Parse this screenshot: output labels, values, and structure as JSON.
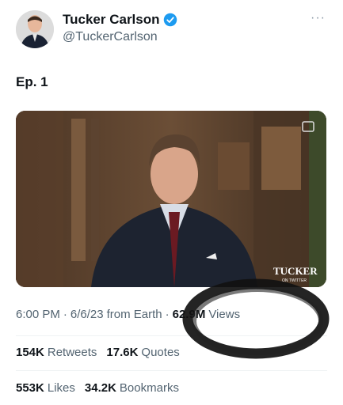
{
  "author": {
    "name": "Tucker Carlson",
    "handle": "@TuckerCarlson"
  },
  "tweet": {
    "text": "Ep. 1"
  },
  "video": {
    "watermark_main": "TUCKER",
    "watermark_sub": "ON TWITTER"
  },
  "meta": {
    "time": "6:00 PM",
    "sep1": "·",
    "date": "6/6/23",
    "source": "from Earth",
    "sep2": "·",
    "views_count": "62.9M",
    "views_label": "Views"
  },
  "stats": {
    "retweets_count": "154K",
    "retweets_label": "Retweets",
    "quotes_count": "17.6K",
    "quotes_label": "Quotes",
    "likes_count": "553K",
    "likes_label": "Likes",
    "bookmarks_count": "34.2K",
    "bookmarks_label": "Bookmarks"
  },
  "colors": {
    "verified": "#1d9bf0",
    "secondary_text": "#536471",
    "primary_text": "#0f1419"
  }
}
